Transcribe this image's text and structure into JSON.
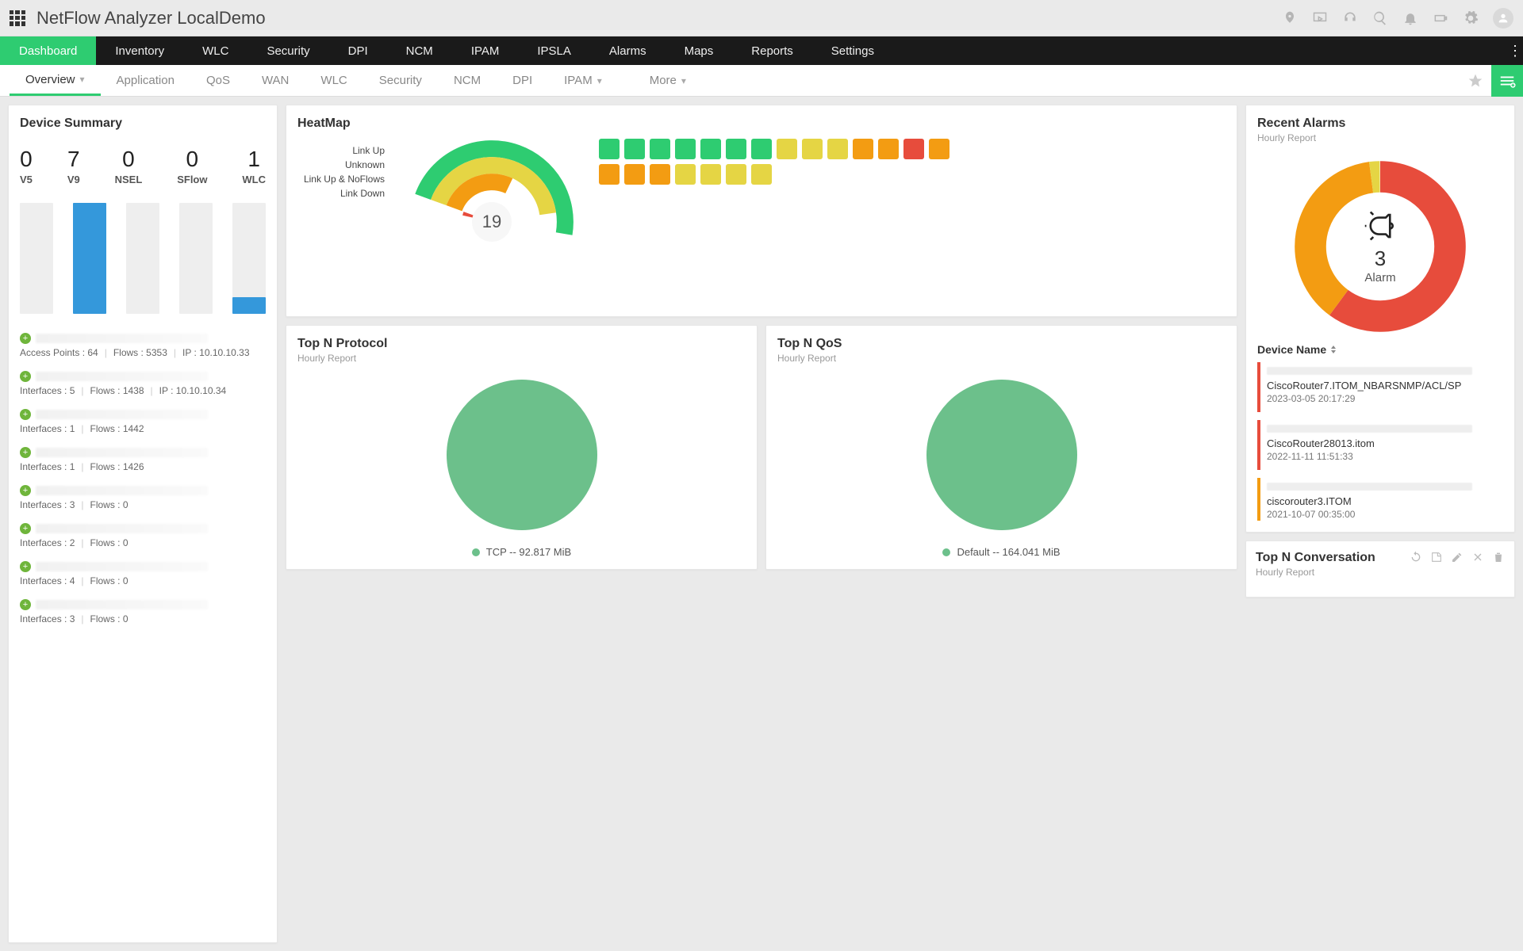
{
  "app": {
    "title": "NetFlow Analyzer LocalDemo"
  },
  "mainnav": [
    {
      "label": "Dashboard",
      "active": true
    },
    {
      "label": "Inventory"
    },
    {
      "label": "WLC"
    },
    {
      "label": "Security"
    },
    {
      "label": "DPI"
    },
    {
      "label": "NCM"
    },
    {
      "label": "IPAM"
    },
    {
      "label": "IPSLA"
    },
    {
      "label": "Alarms"
    },
    {
      "label": "Maps"
    },
    {
      "label": "Reports"
    },
    {
      "label": "Settings"
    }
  ],
  "subnav": {
    "items": [
      {
        "label": "Overview",
        "active": true,
        "hasChevron": true
      },
      {
        "label": "Application"
      },
      {
        "label": "QoS"
      },
      {
        "label": "WAN"
      },
      {
        "label": "WLC"
      },
      {
        "label": "Security"
      },
      {
        "label": "NCM"
      },
      {
        "label": "DPI"
      },
      {
        "label": "IPAM",
        "hasChevron": true
      }
    ],
    "more": "More"
  },
  "deviceSummary": {
    "title": "Device Summary",
    "stats": [
      {
        "lbl": "V5",
        "num": "0",
        "barPct": 0
      },
      {
        "lbl": "V9",
        "num": "7",
        "barPct": 100
      },
      {
        "lbl": "NSEL",
        "num": "0",
        "barPct": 0
      },
      {
        "lbl": "SFlow",
        "num": "0",
        "barPct": 0
      },
      {
        "lbl": "WLC",
        "num": "1",
        "barPct": 15
      }
    ],
    "devices": [
      {
        "meta": [
          "Access Points : 64",
          "Flows : 5353",
          "IP : 10.10.10.33"
        ]
      },
      {
        "meta": [
          "Interfaces : 5",
          "Flows : 1438",
          "IP : 10.10.10.34"
        ]
      },
      {
        "meta": [
          "Interfaces : 1",
          "Flows : 1442"
        ]
      },
      {
        "meta": [
          "Interfaces : 1",
          "Flows : 1426"
        ]
      },
      {
        "meta": [
          "Interfaces : 3",
          "Flows : 0"
        ]
      },
      {
        "meta": [
          "Interfaces : 2",
          "Flows : 0"
        ]
      },
      {
        "meta": [
          "Interfaces : 4",
          "Flows : 0"
        ]
      },
      {
        "meta": [
          "Interfaces : 3",
          "Flows : 0"
        ]
      }
    ]
  },
  "heatmap": {
    "title": "HeatMap",
    "legend": [
      "Link Up",
      "Unknown",
      "Link Up & NoFlows",
      "Link Down"
    ],
    "center": "19",
    "chart_data": {
      "type": "pie",
      "title": "HeatMap",
      "center_value": 19,
      "series": [
        {
          "name": "Link Up",
          "pct": 60,
          "color": "#2ecc71"
        },
        {
          "name": "Unknown",
          "pct": 55,
          "color": "#e5d544"
        },
        {
          "name": "Link Up & NoFlows",
          "pct": 40,
          "color": "#f39c12"
        },
        {
          "name": "Link Down",
          "pct": 8,
          "color": "#e74c3c"
        }
      ]
    },
    "cells": [
      [
        "g",
        "g",
        "g",
        "g",
        "g",
        "g",
        "g",
        "y",
        "y",
        "y",
        "o",
        "o",
        "r",
        "o"
      ],
      [
        "o",
        "o",
        "o",
        "y",
        "y",
        "y",
        "y"
      ]
    ],
    "colors": {
      "g": "#2ecc71",
      "y": "#e5d544",
      "o": "#f39c12",
      "r": "#e74c3c"
    }
  },
  "protocol": {
    "title": "Top N Protocol",
    "sub": "Hourly Report",
    "chart_data": {
      "type": "pie",
      "series": [
        {
          "name": "TCP",
          "value": 92.817,
          "unit": "MiB",
          "pct": 100,
          "color": "#6cc08b"
        }
      ]
    },
    "legend": "TCP -- 92.817 MiB"
  },
  "qos": {
    "title": "Top N QoS",
    "sub": "Hourly Report",
    "chart_data": {
      "type": "pie",
      "series": [
        {
          "name": "Default",
          "value": 164.041,
          "unit": "MiB",
          "pct": 100,
          "color": "#6cc08b"
        }
      ]
    },
    "legend": "Default -- 164.041 MiB"
  },
  "alarms": {
    "title": "Recent Alarms",
    "sub": "Hourly Report",
    "center": {
      "count": "3",
      "label": "Alarm"
    },
    "chart_data": {
      "type": "pie",
      "title": "Recent Alarms",
      "series": [
        {
          "name": "critical",
          "pct": 60,
          "color": "#e74c3c"
        },
        {
          "name": "warning",
          "pct": 38,
          "color": "#f39c12"
        },
        {
          "name": "minor",
          "pct": 2,
          "color": "#e5d544"
        }
      ],
      "center_value": 3,
      "center_label": "Alarm"
    },
    "tableHeader": "Device Name",
    "items": [
      {
        "severity": "#e74c3c",
        "title": "CiscoRouter7.ITOM_NBARSNMP/ACL/SP",
        "time": "2023-03-05 20:17:29"
      },
      {
        "severity": "#e74c3c",
        "title": "CiscoRouter28013.itom",
        "time": "2022-11-11 11:51:33"
      },
      {
        "severity": "#f39c12",
        "title": "ciscorouter3.ITOM",
        "time": "2021-10-07 00:35:00"
      }
    ]
  },
  "conversation": {
    "title": "Top N Conversation",
    "sub": "Hourly Report"
  }
}
